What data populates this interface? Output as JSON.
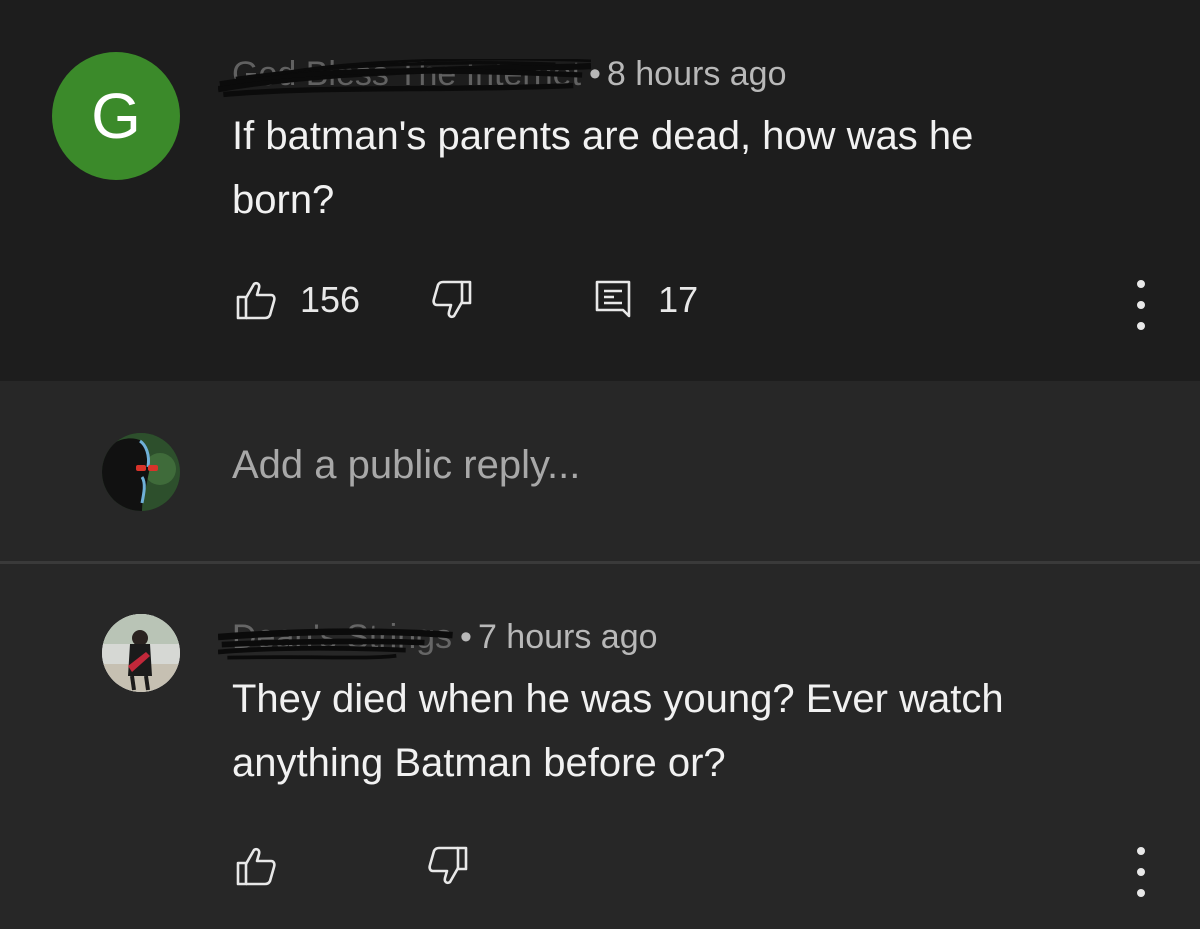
{
  "comment": {
    "avatar_letter": "G",
    "avatar_color": "#3b8a2a",
    "author": "God Bless The Internet",
    "time": "8 hours ago",
    "text_line1": "If batman's parents are dead, how was he",
    "text_line2": "born?",
    "likes": "156",
    "replies": "17"
  },
  "reply_box": {
    "placeholder": "Add a public reply..."
  },
  "reply": {
    "author": "Dean's Strings",
    "time": "7 hours ago",
    "text_line1": "They died when he was young? Ever watch",
    "text_line2": "anything Batman before or?"
  },
  "separator": "•",
  "icons": {
    "like": "thumbs-up-icon",
    "dislike": "thumbs-down-icon",
    "reply": "comment-icon",
    "more": "more-vertical-icon"
  }
}
